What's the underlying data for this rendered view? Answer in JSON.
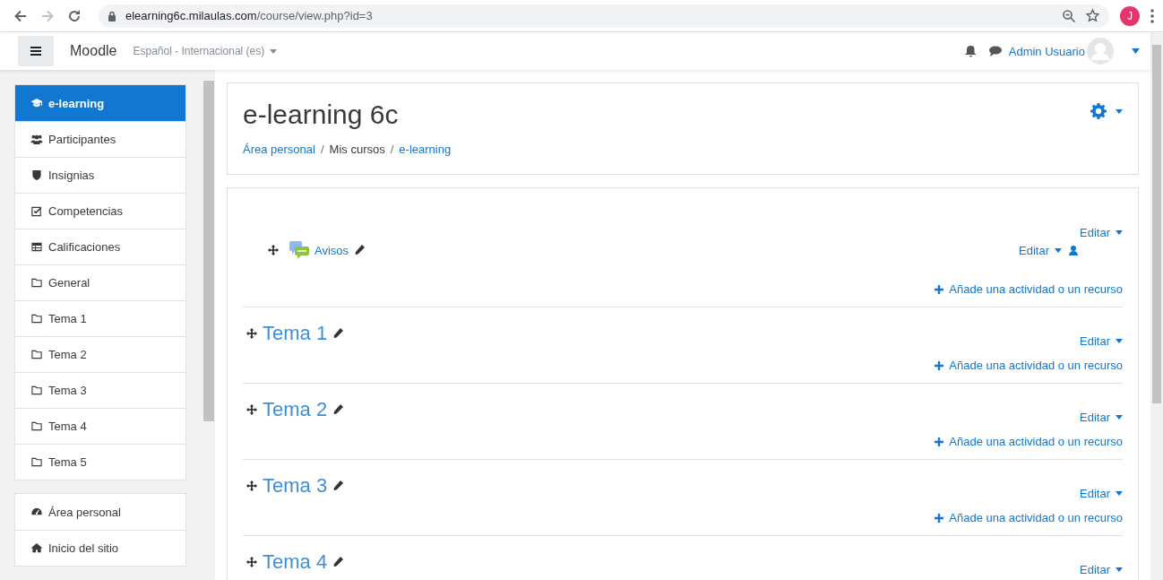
{
  "browser": {
    "url": {
      "host": "elearning6c.milaulas.com",
      "path": "/course/view.php?id=3"
    },
    "profile": "J"
  },
  "navbar": {
    "brand": "Moodle",
    "language": "Español - Internacional (es)",
    "user": "Admin Usuario"
  },
  "sidebar": {
    "groups": [
      [
        {
          "label": "e-learning",
          "kind": "course",
          "selected": true
        },
        {
          "label": "Participantes",
          "kind": "participants",
          "selected": false
        },
        {
          "label": "Insignias",
          "kind": "badges",
          "selected": false
        },
        {
          "label": "Competencias",
          "kind": "competencies",
          "selected": false
        },
        {
          "label": "Calificaciones",
          "kind": "grades",
          "selected": false
        },
        {
          "label": "General",
          "kind": "section",
          "selected": false
        },
        {
          "label": "Tema 1",
          "kind": "section",
          "selected": false
        },
        {
          "label": "Tema 2",
          "kind": "section",
          "selected": false
        },
        {
          "label": "Tema 3",
          "kind": "section",
          "selected": false
        },
        {
          "label": "Tema 4",
          "kind": "section",
          "selected": false
        },
        {
          "label": "Tema 5",
          "kind": "section",
          "selected": false
        }
      ],
      [
        {
          "label": "Área personal",
          "kind": "dashboard",
          "selected": false
        },
        {
          "label": "Inicio del sitio",
          "kind": "home",
          "selected": false
        }
      ]
    ]
  },
  "header": {
    "title": "e-learning 6c",
    "breadcrumb_separator": "/",
    "breadcrumbs": [
      {
        "label": "Área personal",
        "link": true
      },
      {
        "label": "Mis cursos",
        "link": false
      },
      {
        "label": "e-learning",
        "link": true
      }
    ]
  },
  "sections": [
    {
      "kind": "general",
      "edit": "Editar",
      "activities": [
        {
          "name": "Avisos",
          "edit": "Editar"
        }
      ],
      "add": "Añade una actividad o un recurso"
    },
    {
      "kind": "topic",
      "title": "Tema 1",
      "edit": "Editar",
      "add": "Añade una actividad o un recurso"
    },
    {
      "kind": "topic",
      "title": "Tema 2",
      "edit": "Editar",
      "add": "Añade una actividad o un recurso"
    },
    {
      "kind": "topic",
      "title": "Tema 3",
      "edit": "Editar",
      "add": "Añade una actividad o un recurso"
    },
    {
      "kind": "topic",
      "title": "Tema 4",
      "edit": "Editar"
    }
  ]
}
